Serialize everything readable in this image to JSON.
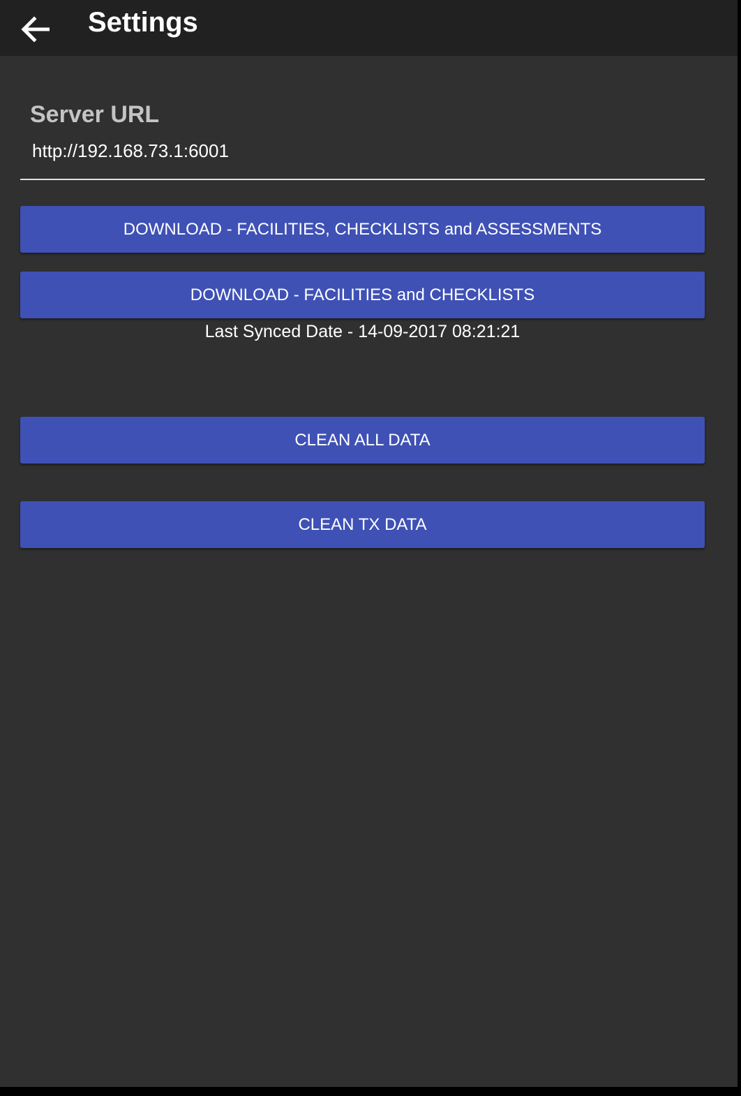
{
  "toolbar": {
    "title": "Settings",
    "back_icon": "arrow-back-icon"
  },
  "server": {
    "label": "Server URL",
    "url_value": "http://192.168.73.1:6001"
  },
  "actions": {
    "download_all_label": "DOWNLOAD - FACILITIES, CHECKLISTS and ASSESSMENTS",
    "download_facilities_label": "DOWNLOAD - FACILITIES and CHECKLISTS",
    "last_synced": "Last Synced Date - 14-09-2017 08:21:21",
    "clean_all_label": "CLEAN ALL DATA",
    "clean_tx_label": "CLEAN TX DATA"
  },
  "colors": {
    "toolbar_bg": "#212121",
    "page_bg": "#303030",
    "button_bg": "#3f51b5",
    "label_text": "#c4c4c4"
  }
}
